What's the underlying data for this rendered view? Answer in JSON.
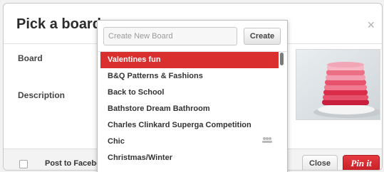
{
  "dialog": {
    "title": "Pick a board",
    "close_glyph": "×",
    "board_label": "Board",
    "description_label": "Description"
  },
  "dropdown": {
    "create_placeholder": "Create New Board",
    "create_button": "Create",
    "items": [
      {
        "label": "Valentines fun",
        "selected": true,
        "shared": false
      },
      {
        "label": "B&Q Patterns & Fashions",
        "selected": false,
        "shared": false
      },
      {
        "label": "Back to School",
        "selected": false,
        "shared": false
      },
      {
        "label": "Bathstore Dream Bathroom",
        "selected": false,
        "shared": false
      },
      {
        "label": "Charles Clinkard Superga Competition",
        "selected": false,
        "shared": false
      },
      {
        "label": "Chic",
        "selected": false,
        "shared": true
      },
      {
        "label": "Christmas/Winter",
        "selected": false,
        "shared": false
      }
    ],
    "shared_icon": "group-icon"
  },
  "footer": {
    "post_label": "Post to Facebo",
    "close_button": "Close",
    "pin_button": "Pin it"
  },
  "colors": {
    "accent_red": "#d9302f",
    "pin_button": "#cb2027"
  }
}
